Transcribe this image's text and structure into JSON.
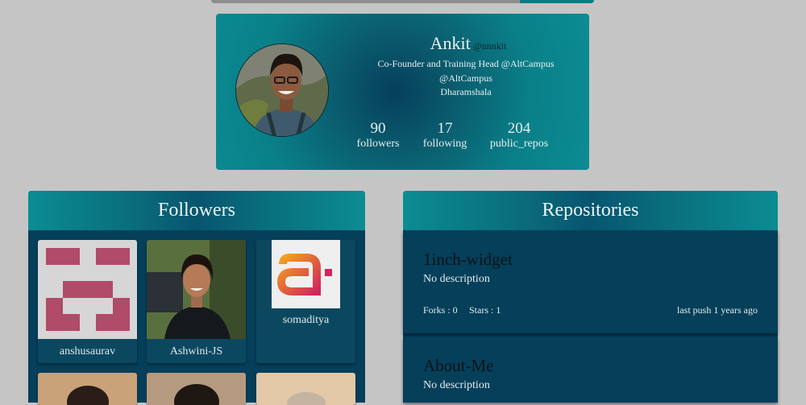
{
  "colors": {
    "background": "#c5c5c5",
    "accent": "#0b8c93",
    "panel": "#053f5a"
  },
  "profile": {
    "name": "Ankit",
    "handle": "@nnnkit",
    "bio": "Co-Founder and Training Head @AltCampus",
    "company": "@AltCampus",
    "location": "Dharamshala",
    "stats": [
      {
        "value": "90",
        "label": "followers"
      },
      {
        "value": "17",
        "label": "following"
      },
      {
        "value": "204",
        "label": "public_repos"
      }
    ]
  },
  "followers": {
    "title": "Followers",
    "items": [
      {
        "username": "anshusaurav"
      },
      {
        "username": "Ashwini-JS"
      },
      {
        "username": "somaditya"
      }
    ]
  },
  "repositories": {
    "title": "Repositories",
    "items": [
      {
        "name": "1inch-widget",
        "description": "No description",
        "forks": "Forks : 0",
        "stars": "Stars : 1",
        "last_push": "last push 1 years ago"
      },
      {
        "name": "About-Me",
        "description": "No description"
      }
    ]
  }
}
